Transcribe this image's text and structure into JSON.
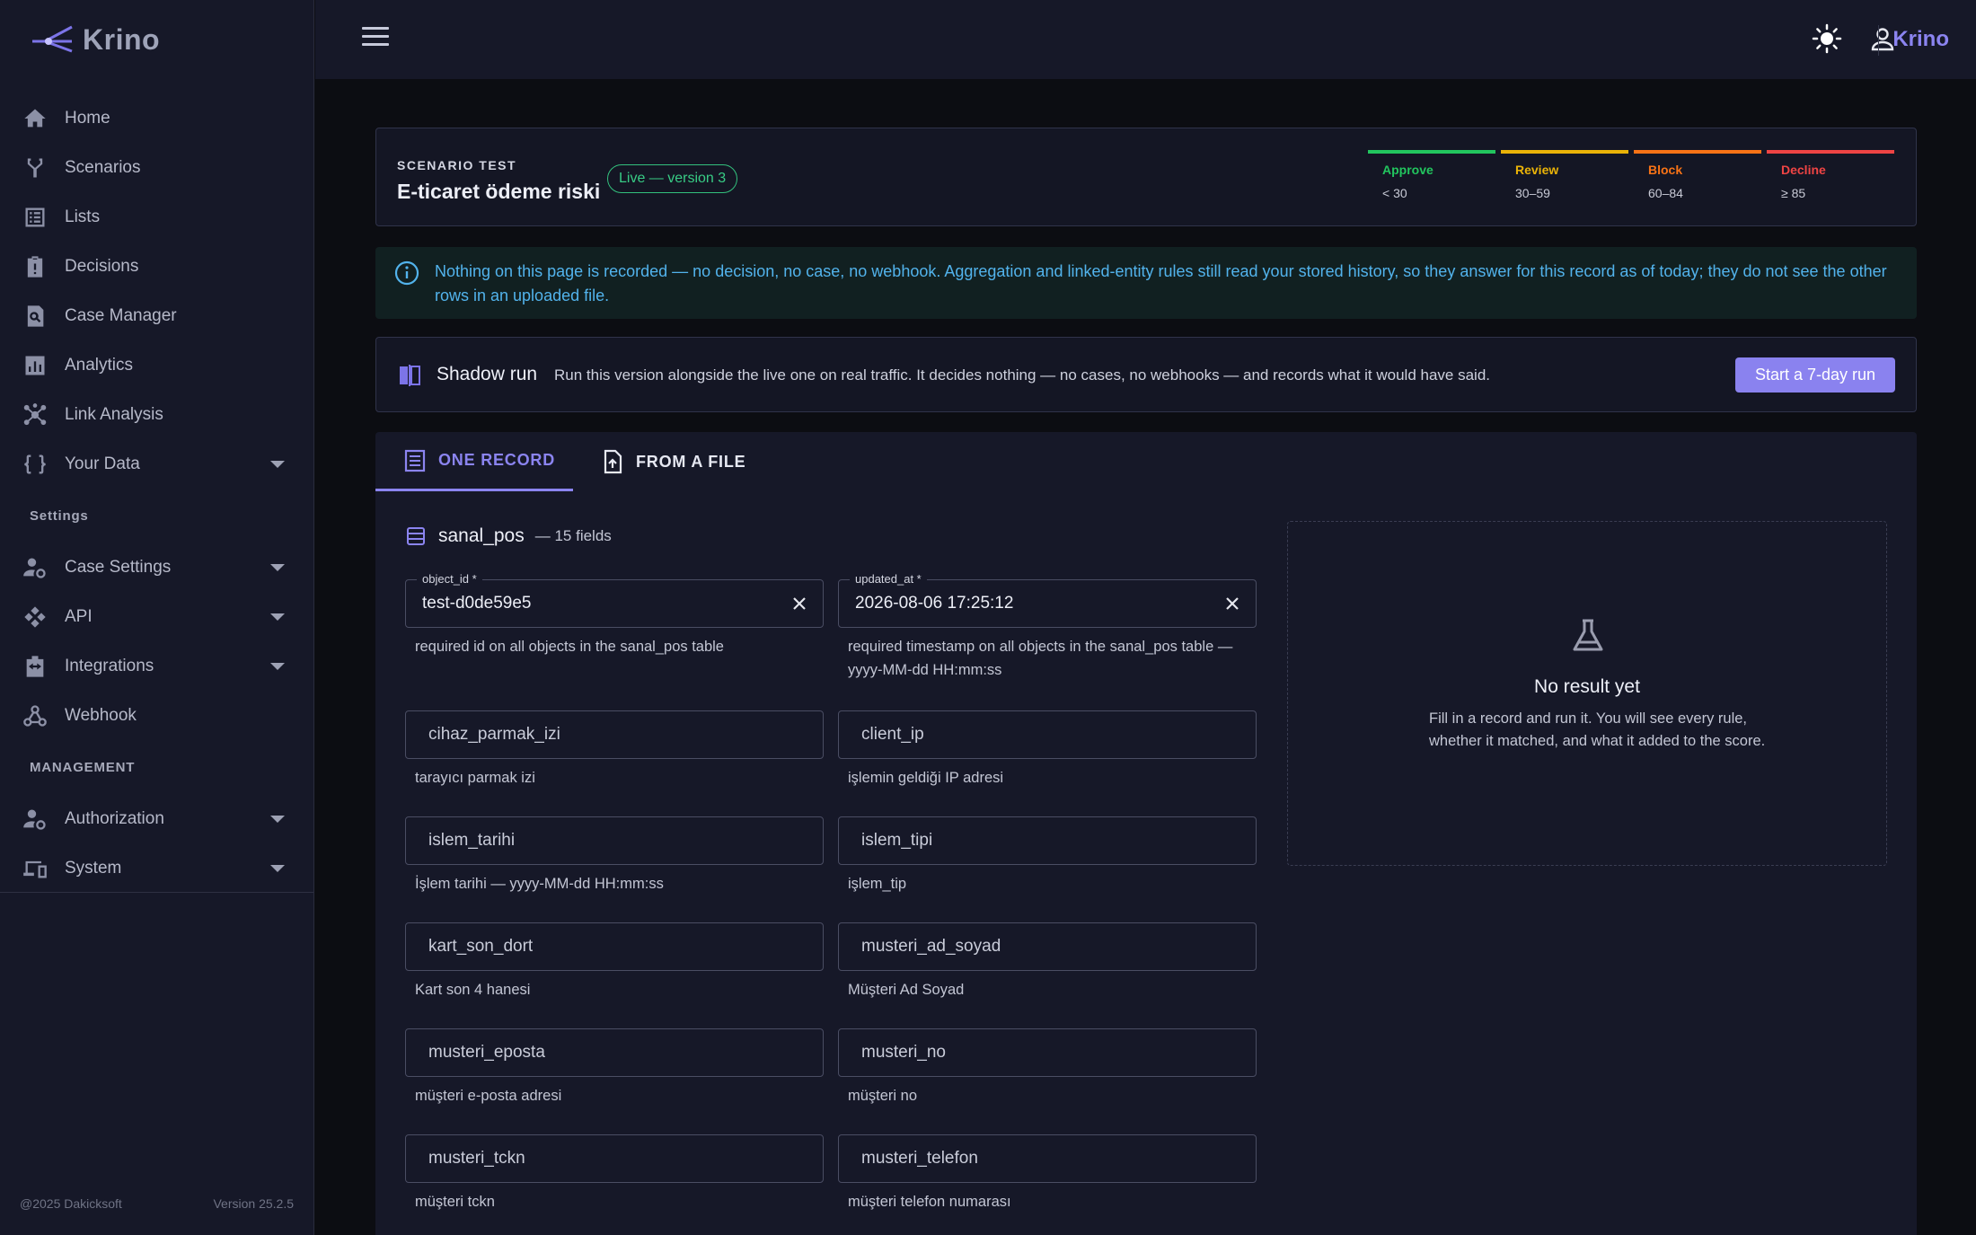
{
  "app": {
    "logo_text": "Krino",
    "brand_right": "Krino"
  },
  "sidebar": {
    "items": [
      {
        "label": "Home",
        "icon": "home-icon"
      },
      {
        "label": "Scenarios",
        "icon": "fork-icon"
      },
      {
        "label": "Lists",
        "icon": "list-icon"
      },
      {
        "label": "Decisions",
        "icon": "clipboard-icon"
      },
      {
        "label": "Case Manager",
        "icon": "search-doc-icon"
      },
      {
        "label": "Analytics",
        "icon": "bar-chart-icon"
      },
      {
        "label": "Link Analysis",
        "icon": "hub-icon"
      },
      {
        "label": "Your Data",
        "icon": "braces-icon"
      }
    ],
    "section_settings": "Settings",
    "settings_items": [
      {
        "label": "Case Settings",
        "icon": "user-gear-icon"
      },
      {
        "label": "API",
        "icon": "api-icon"
      },
      {
        "label": "Integrations",
        "icon": "integration-icon"
      },
      {
        "label": "Webhook",
        "icon": "webhook-icon"
      }
    ],
    "section_management": "MANAGEMENT",
    "management_items": [
      {
        "label": "Authorization",
        "icon": "user-gear-icon"
      },
      {
        "label": "System",
        "icon": "devices-icon"
      }
    ],
    "footer_left": "@2025 Dakicksoft",
    "footer_right": "Version 25.2.5"
  },
  "scenario": {
    "label": "SCENARIO TEST",
    "title": "E-ticaret ödeme riski",
    "badge": "Live — version 3",
    "thresholds": [
      {
        "name": "Approve",
        "range": "< 30",
        "color": "#22c55e"
      },
      {
        "name": "Review",
        "range": "30–59",
        "color": "#eab308"
      },
      {
        "name": "Block",
        "range": "60–84",
        "color": "#f97316"
      },
      {
        "name": "Decline",
        "range": "≥ 85",
        "color": "#ef4444"
      }
    ]
  },
  "info": {
    "text": "Nothing on this page is recorded — no decision, no case, no webhook. Aggregation and linked-entity rules still read your stored history, so they answer for this record as of today; they do not see the other rows in an uploaded file."
  },
  "shadow": {
    "title": "Shadow run",
    "description": "Run this version alongside the live one on real traffic. It decides nothing — no cases, no webhooks — and records what it would have said.",
    "button": "Start a 7-day run"
  },
  "tabs": {
    "one_record": "ONE RECORD",
    "from_file": "FROM A FILE"
  },
  "table": {
    "name": "sanal_pos",
    "count": "— 15 fields"
  },
  "fields": [
    {
      "label": "object_id *",
      "value": "test-d0de59e5",
      "help": "required id on all objects in the sanal_pos table"
    },
    {
      "label": "updated_at *",
      "value": "2026-08-06 17:25:12",
      "help": "required timestamp on all objects in the sanal_pos table — yyyy-MM-dd HH:mm:ss"
    },
    {
      "placeholder": "cihaz_parmak_izi",
      "help": "tarayıcı parmak izi"
    },
    {
      "placeholder": "client_ip",
      "help": "işlemin geldiği IP adresi"
    },
    {
      "placeholder": "islem_tarihi",
      "help": "İşlem tarihi — yyyy-MM-dd HH:mm:ss"
    },
    {
      "placeholder": "islem_tipi",
      "help": "işlem_tip"
    },
    {
      "placeholder": "kart_son_dort",
      "help": "Kart son 4 hanesi"
    },
    {
      "placeholder": "musteri_ad_soyad",
      "help": "Müşteri Ad Soyad"
    },
    {
      "placeholder": "musteri_eposta",
      "help": "müşteri e-posta adresi"
    },
    {
      "placeholder": "musteri_no",
      "help": "müşteri no"
    },
    {
      "placeholder": "musteri_tckn",
      "help": "müşteri tckn"
    },
    {
      "placeholder": "musteri_telefon",
      "help": "müşteri telefon numarası"
    }
  ],
  "result": {
    "title": "No result yet",
    "description": "Fill in a record and run it. You will see every rule, whether it matched, and what it added to the score."
  }
}
